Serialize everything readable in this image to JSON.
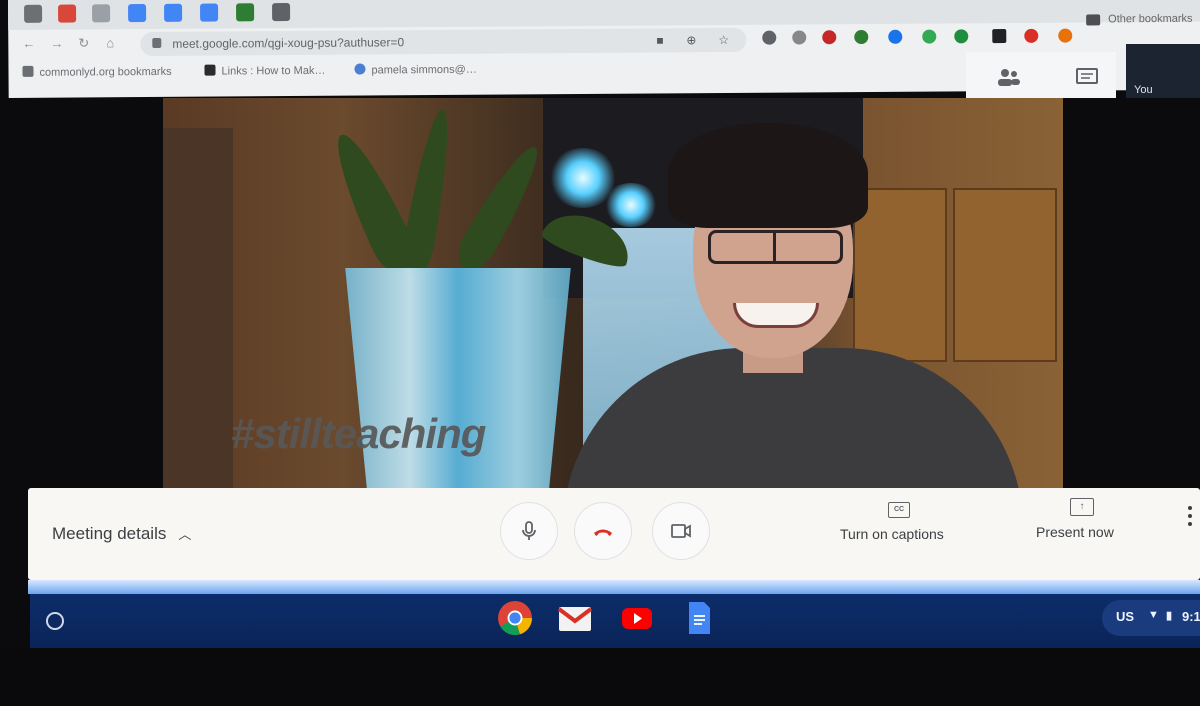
{
  "browser": {
    "url": "meet.google.com/qgi-xoug-psu?authuser=0",
    "other_bookmarks": "Other bookmarks",
    "bookmarks": [
      {
        "label": "commonlyd.org bookmarks",
        "color": "#6b6f73"
      },
      {
        "label": "Links : How to Mak…",
        "color": "#2b2b2b"
      },
      {
        "label": "pamela simmons@…",
        "color": "#4a7fd4"
      }
    ]
  },
  "meet": {
    "self_label": "You",
    "watermark": "#stillteaching",
    "meeting_details": "Meeting details",
    "captions_label": "Turn on captions",
    "captions_icon_text": "CC",
    "present_label": "Present now"
  },
  "shelf": {
    "locale": "US",
    "clock": "9:1"
  },
  "colors": {
    "end_call": "#d93025",
    "shelf": "#0c2d6a"
  }
}
